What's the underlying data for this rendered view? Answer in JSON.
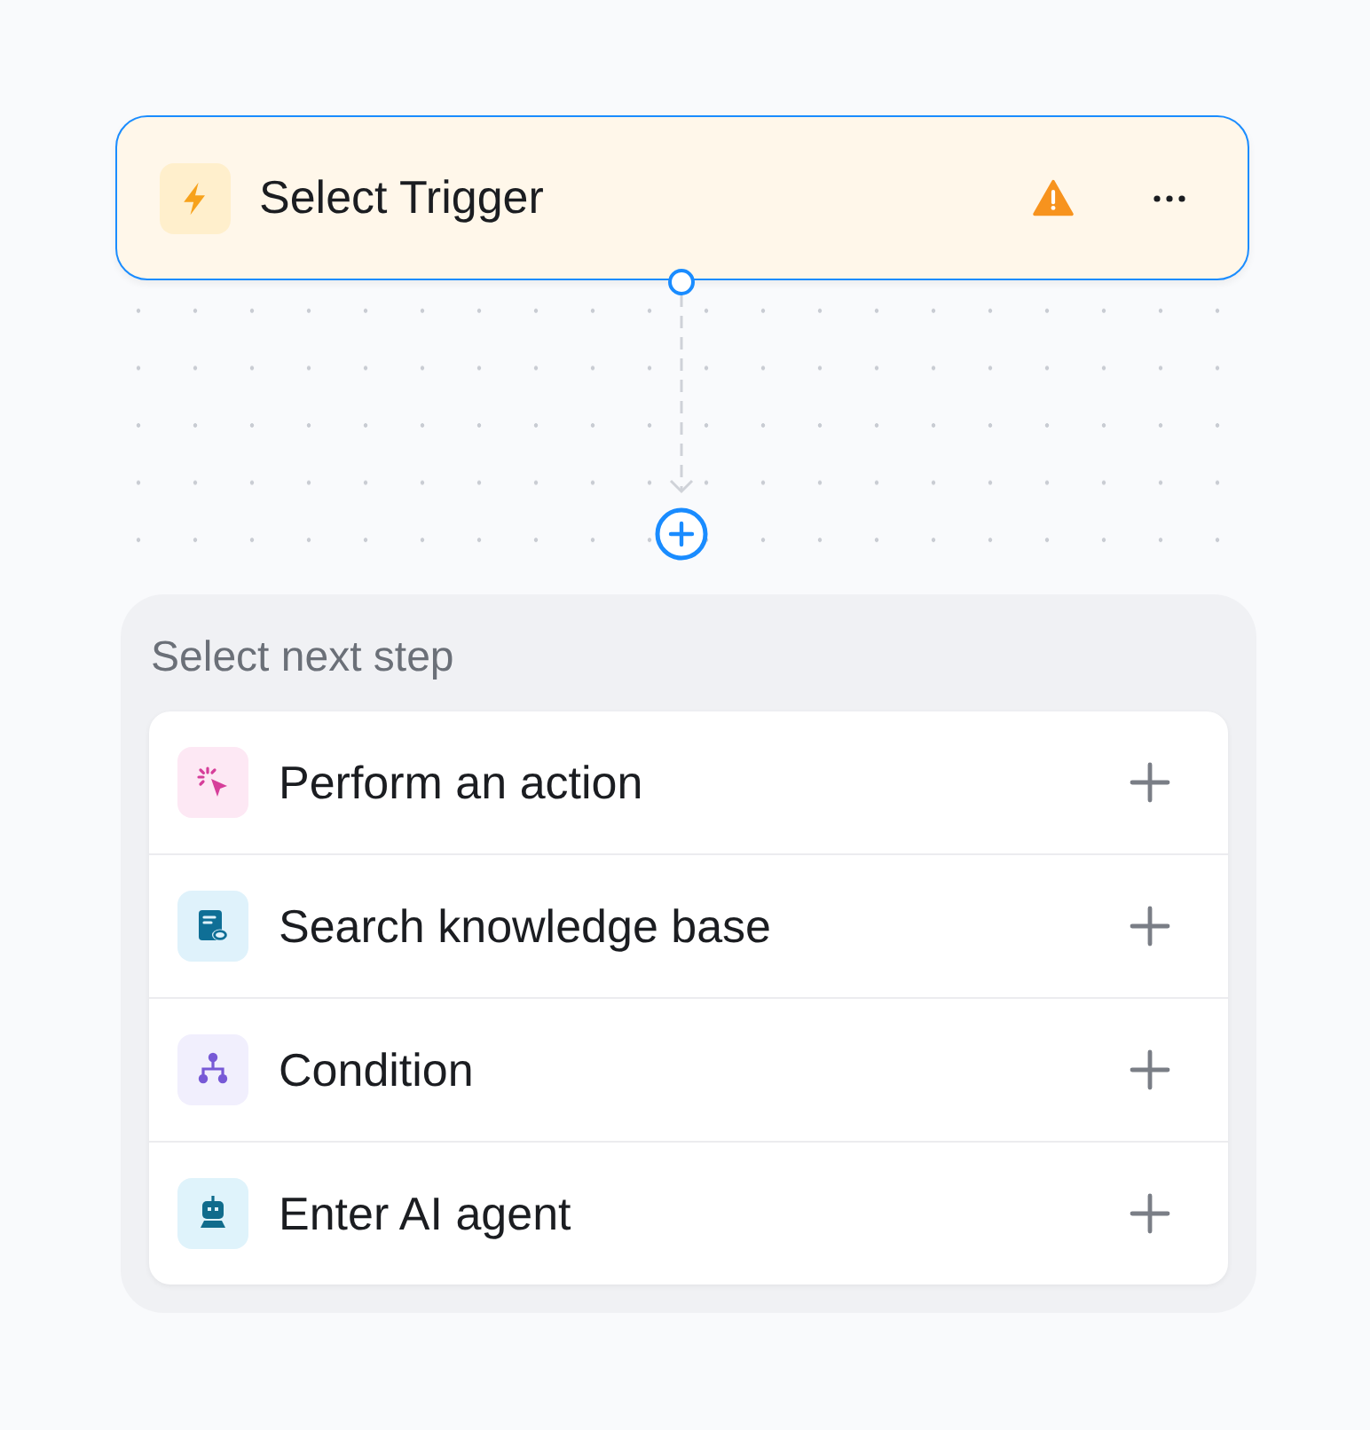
{
  "trigger": {
    "title": "Select Trigger",
    "warning": true
  },
  "next_step": {
    "heading": "Select next step",
    "items": [
      {
        "kind": "action",
        "label": "Perform an action"
      },
      {
        "kind": "knowledge",
        "label": "Search knowledge base"
      },
      {
        "kind": "condition",
        "label": "Condition"
      },
      {
        "kind": "agent",
        "label": "Enter AI agent"
      }
    ]
  }
}
